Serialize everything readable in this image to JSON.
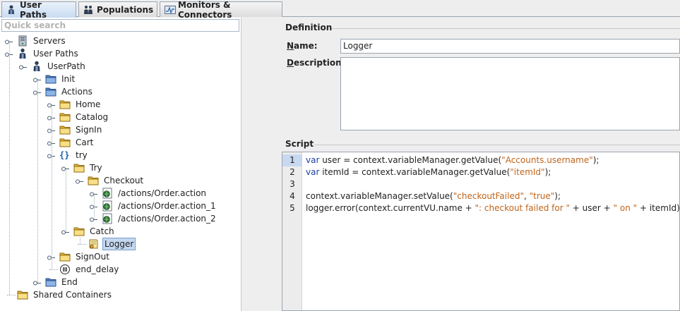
{
  "tabs": [
    {
      "label": "User Paths",
      "icon": "user-paths-icon",
      "active": true
    },
    {
      "label": "Populations",
      "icon": "populations-icon",
      "active": false
    },
    {
      "label": "Monitors & Connectors",
      "icon": "monitors-icon",
      "active": false
    }
  ],
  "search": {
    "placeholder": "Quick search"
  },
  "tree": [
    {
      "label": "Servers",
      "icon": "server-icon"
    },
    {
      "label": "User Paths",
      "icon": "user-icon"
    },
    {
      "label": "UserPath",
      "icon": "user-icon"
    },
    {
      "label": "Init",
      "icon": "folder-blue-icon"
    },
    {
      "label": "Actions",
      "icon": "folder-blue-icon"
    },
    {
      "label": "Home",
      "icon": "folder-yellow-icon"
    },
    {
      "label": "Catalog",
      "icon": "folder-yellow-icon"
    },
    {
      "label": "SignIn",
      "icon": "folder-yellow-icon"
    },
    {
      "label": "Cart",
      "icon": "folder-yellow-icon"
    },
    {
      "label": "try",
      "icon": "braces-icon"
    },
    {
      "label": "Try",
      "icon": "folder-yellow-icon"
    },
    {
      "label": "Checkout",
      "icon": "folder-yellow-icon"
    },
    {
      "label": "/actions/Order.action",
      "icon": "request-icon"
    },
    {
      "label": "/actions/Order.action_1",
      "icon": "request-icon"
    },
    {
      "label": "/actions/Order.action_2",
      "icon": "request-icon"
    },
    {
      "label": "Catch",
      "icon": "folder-yellow-icon"
    },
    {
      "label": "Logger",
      "icon": "script-icon",
      "selected": true
    },
    {
      "label": "SignOut",
      "icon": "folder-yellow-icon"
    },
    {
      "label": "end_delay",
      "icon": "delay-icon"
    },
    {
      "label": "End",
      "icon": "folder-blue-icon"
    },
    {
      "label": "Shared Containers",
      "icon": "folder-yellow-icon"
    }
  ],
  "definition": {
    "title": "Definition",
    "name_label": "Name:",
    "name_value": "Logger",
    "description_label": "Description:",
    "description_value": ""
  },
  "script": {
    "title": "Script",
    "current_line": 1,
    "lines": [
      {
        "n": "1",
        "code": [
          {
            "t": "var",
            "c": "kw"
          },
          {
            "t": " user = context.variableManager.getValue("
          },
          {
            "t": "\"Accounts.username\"",
            "c": "str"
          },
          {
            "t": ");"
          }
        ]
      },
      {
        "n": "2",
        "code": [
          {
            "t": "var",
            "c": "kw"
          },
          {
            "t": " itemId = context.variableManager.getValue("
          },
          {
            "t": "\"itemId\"",
            "c": "str"
          },
          {
            "t": ");"
          }
        ]
      },
      {
        "n": "3",
        "code": []
      },
      {
        "n": "4",
        "code": [
          {
            "t": "context.variableManager.setValue("
          },
          {
            "t": "\"checkoutFailed\"",
            "c": "str"
          },
          {
            "t": ", "
          },
          {
            "t": "\"true\"",
            "c": "str"
          },
          {
            "t": ");"
          }
        ]
      },
      {
        "n": "5",
        "code": [
          {
            "t": "logger.error(context.currentVU.name + "
          },
          {
            "t": "\": checkout failed for \"",
            "c": "str"
          },
          {
            "t": " + user + "
          },
          {
            "t": "\" on \"",
            "c": "str"
          },
          {
            "t": " + itemId);"
          }
        ]
      }
    ]
  },
  "colors": {
    "keyword": "#1a3fa8",
    "string": "#c0641a",
    "selection": "#c4d7ee"
  }
}
